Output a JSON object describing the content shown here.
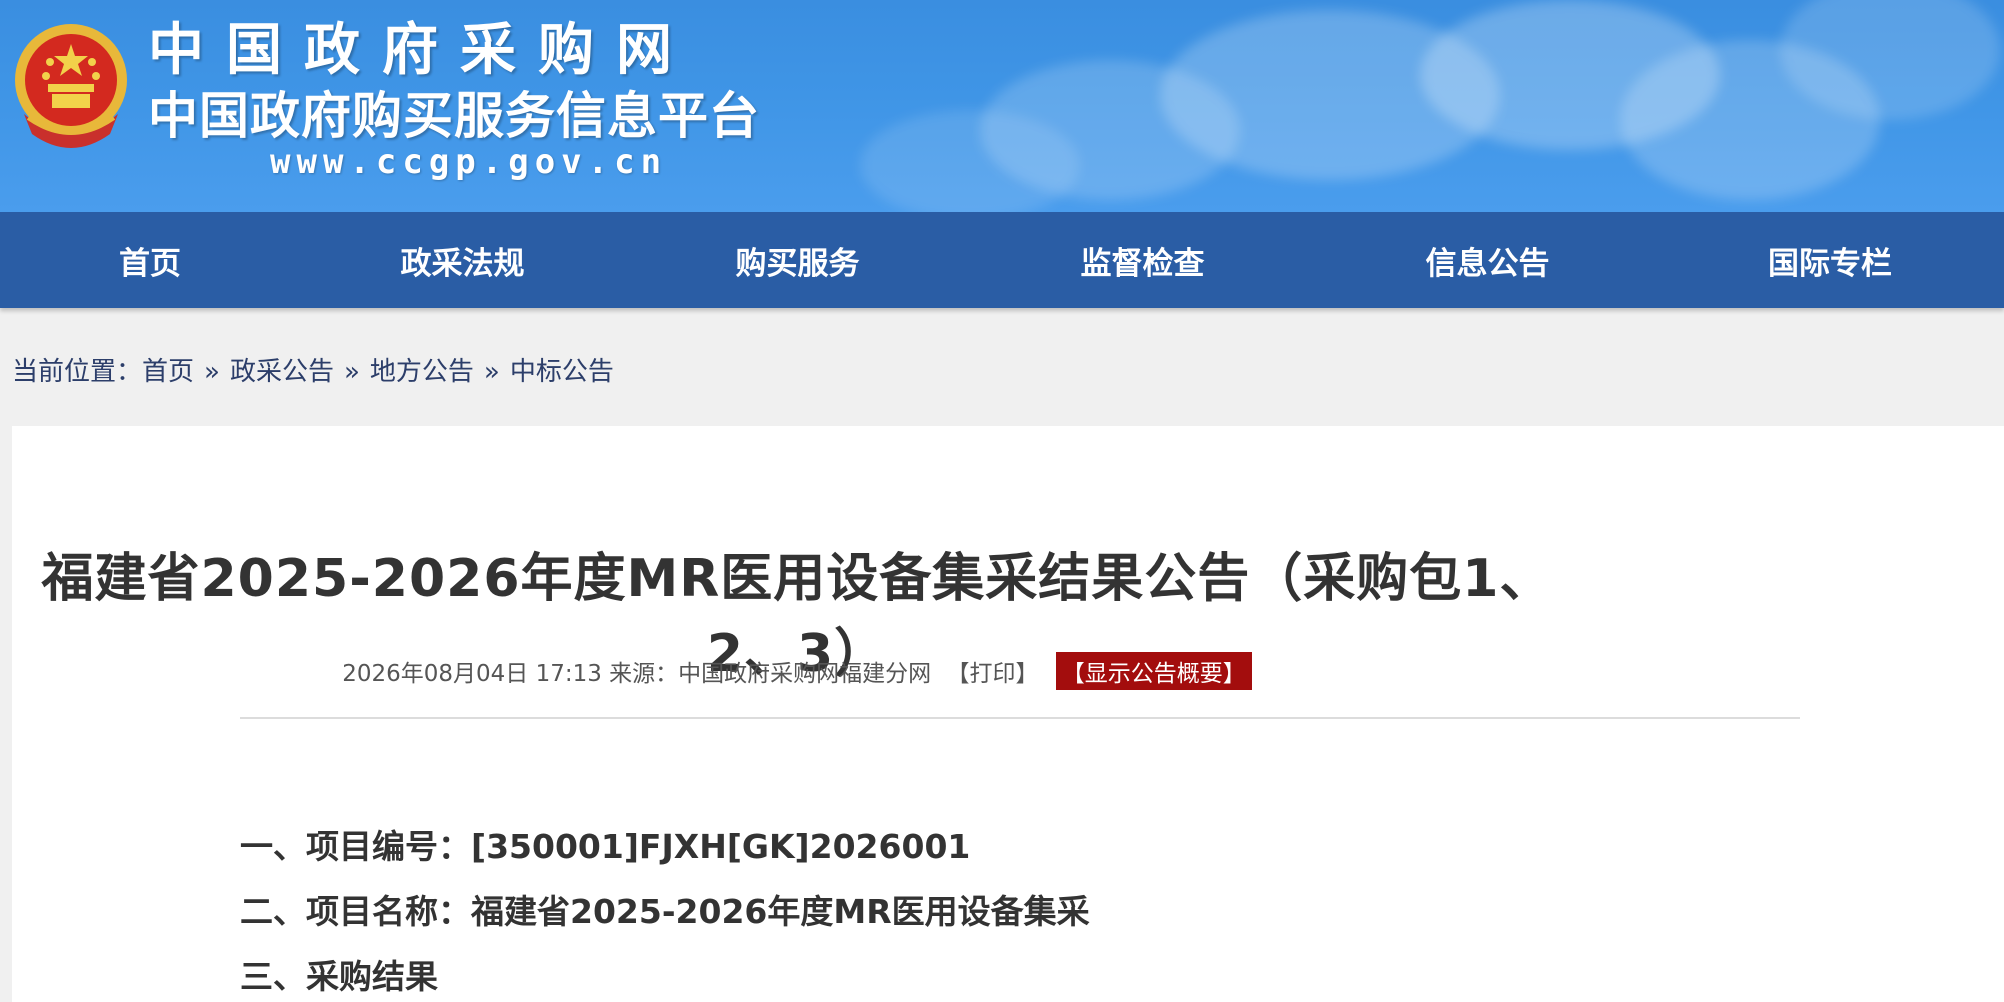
{
  "header": {
    "site_name": "中国政府采购网",
    "site_subtitle": "中国政府购买服务信息平台",
    "site_url": "www.ccgp.gov.cn",
    "emblem_icon": "national-emblem-icon"
  },
  "nav": {
    "items": [
      {
        "label": "首页"
      },
      {
        "label": "政采法规"
      },
      {
        "label": "购买服务"
      },
      {
        "label": "监督检查"
      },
      {
        "label": "信息公告"
      },
      {
        "label": "国际专栏"
      }
    ]
  },
  "breadcrumb": {
    "prefix": "当前位置：",
    "items": [
      {
        "label": "首页"
      },
      {
        "label": "政采公告"
      },
      {
        "label": "地方公告"
      },
      {
        "label": "中标公告"
      }
    ],
    "separator": "»"
  },
  "article": {
    "title": "福建省2025-2026年度MR医用设备集采结果公告（采购包1、2、3）",
    "date": "2026年08月04日 17:13",
    "source_label": "来源：",
    "source": "中国政府采购网福建分网",
    "print_label": "【打印】",
    "summary_label": "【显示公告概要】",
    "sections": [
      {
        "label": "一、项目编号：[350001]FJXH[GK]2026001"
      },
      {
        "label": "二、项目名称：福建省2025-2026年度MR医用设备集采"
      },
      {
        "label": "三、采购结果"
      }
    ]
  },
  "colors": {
    "nav_bg": "#2a5da5",
    "banner_bg": "#3f95e6",
    "summary_bg": "#a30d0d"
  }
}
